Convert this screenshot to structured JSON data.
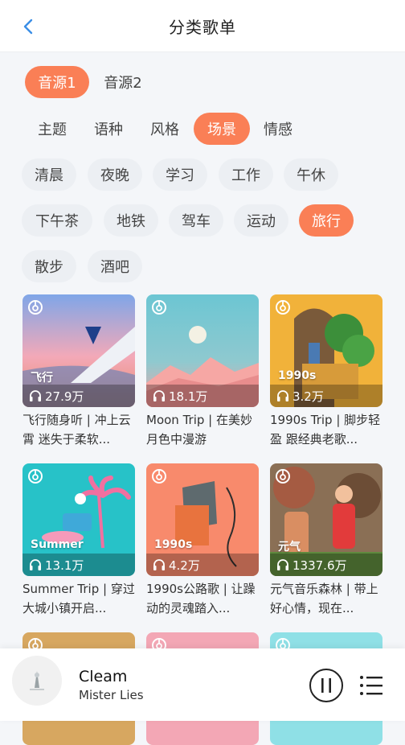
{
  "header": {
    "title": "分类歌单",
    "back_icon": "chevron-left-icon",
    "accent": "#3a8ee6"
  },
  "sources": [
    {
      "label": "音源1",
      "active": true
    },
    {
      "label": "音源2",
      "active": false
    }
  ],
  "categories": [
    {
      "label": "主题",
      "active": false
    },
    {
      "label": "语种",
      "active": false
    },
    {
      "label": "风格",
      "active": false
    },
    {
      "label": "场景",
      "active": true
    },
    {
      "label": "情感",
      "active": false
    }
  ],
  "scenes": [
    {
      "label": "清晨",
      "active": false
    },
    {
      "label": "夜晚",
      "active": false
    },
    {
      "label": "学习",
      "active": false
    },
    {
      "label": "工作",
      "active": false
    },
    {
      "label": "午休",
      "active": false
    },
    {
      "label": "下午茶",
      "active": false
    },
    {
      "label": "地铁",
      "active": false
    },
    {
      "label": "驾车",
      "active": false
    },
    {
      "label": "运动",
      "active": false
    },
    {
      "label": "旅行",
      "active": true
    },
    {
      "label": "散步",
      "active": false
    },
    {
      "label": "酒吧",
      "active": false
    }
  ],
  "colors": {
    "accent": "#fa7f56",
    "chip_bg": "#eceff3",
    "page_bg": "#f4f6f9"
  },
  "playlists": [
    {
      "tag": "飞行",
      "plays": "27.9万",
      "title": "飞行随身听 | 冲上云霄 迷失于柔软..."
    },
    {
      "tag": "",
      "plays": "18.1万",
      "title": "Moon Trip | 在美妙月色中漫游"
    },
    {
      "tag": "1990s",
      "plays": "3.2万",
      "title": "1990s Trip | 脚步轻盈 跟经典老歌..."
    },
    {
      "tag": "Summer",
      "plays": "13.1万",
      "title": "Summer Trip | 穿过大城小镇开启..."
    },
    {
      "tag": "1990s",
      "plays": "4.2万",
      "title": "1990s公路歌 | 让躁动的灵魂踏入..."
    },
    {
      "tag": "元气",
      "plays": "1337.6万",
      "title": "元气音乐森林 | 带上好心情，现在..."
    }
  ],
  "player": {
    "song": "Cleam",
    "artist": "Mister Lies",
    "pause_icon": "pause-circle-icon",
    "list_icon": "playlist-icon"
  }
}
